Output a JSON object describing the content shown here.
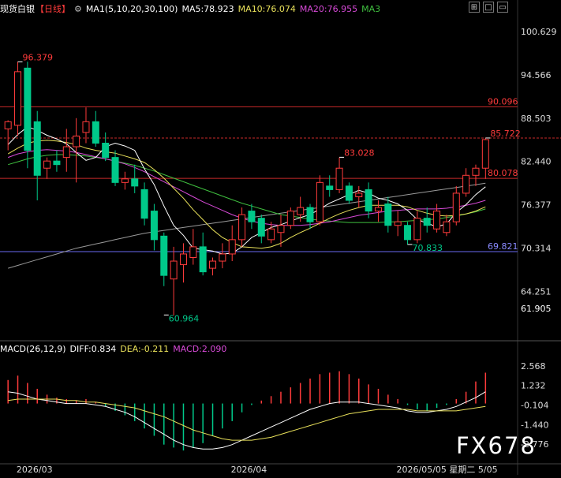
{
  "header": {
    "symbol": "现货白银",
    "period": "【日线】",
    "gear_icon": "gear-icon",
    "ma_label": "MA1(5,10,20,30,100)",
    "ma5": "MA5:78.923",
    "ma10": "MA10:76.074",
    "ma20": "MA20:76.955",
    "ma3": "MA3"
  },
  "window_buttons": [
    "grid-icon",
    "maximize-icon",
    "restore-icon"
  ],
  "macd_header": {
    "label": "MACD(26,12,9)",
    "diff": "DIFF:0.834",
    "dea": "DEA:-0.211",
    "macd": "MACD:2.090"
  },
  "watermark": "FX678",
  "colors": {
    "up": "#ff3b3b",
    "down": "#00c98a",
    "ma5": "#ffffff",
    "ma10": "#e8e05a",
    "ma20": "#d84ad8",
    "ma30": "#3fbf3f",
    "ma100": "#9a9a9a",
    "hline_red": "#c92a2a",
    "hline_blue": "#6a6af0"
  },
  "chart_data": [
    {
      "type": "candlestick",
      "title": "现货白银【日线】",
      "ylim": [
        57.8,
        102.6
      ],
      "yticks": [
        "100.629",
        "94.566",
        "88.503",
        "82.440",
        "76.377",
        "70.314",
        "64.251"
      ],
      "ytick_values": [
        100.629,
        94.566,
        88.503,
        82.44,
        76.377,
        70.314,
        64.251
      ],
      "current_price_label": "61.905",
      "current_price_value": 61.905,
      "xlabels": [
        "2026/03",
        "2026/04",
        "2026/05/05 星期二 5/05"
      ],
      "xlabel_index": [
        2,
        24,
        41
      ],
      "annotations": [
        {
          "text": "96.379",
          "value": 96.379,
          "index": 1,
          "color": "#ff3b3b"
        },
        {
          "text": "83.028",
          "value": 83.028,
          "index": 34,
          "color": "#ff3b3b"
        },
        {
          "text": "60.964",
          "value": 60.964,
          "index": 16,
          "color": "#00c98a"
        },
        {
          "text": "70.833",
          "value": 70.833,
          "index": 41,
          "color": "#00c98a"
        },
        {
          "text": "85.722",
          "value": 85.722,
          "index": 49,
          "color": "#ff3b3b"
        }
      ],
      "hlines": [
        {
          "value": 90.096,
          "label": "90.096",
          "color": "#c92a2a"
        },
        {
          "value": 80.078,
          "label": "80.078",
          "color": "#c92a2a"
        },
        {
          "value": 69.821,
          "label": "69.821",
          "color": "#6a6af0"
        },
        {
          "value": 85.722,
          "label": "",
          "color": "#c92a2a",
          "dashed": true
        }
      ],
      "candles": [
        {
          "o": 87.0,
          "h": 88.2,
          "l": 84.0,
          "c": 88.0
        },
        {
          "o": 87.5,
          "h": 96.4,
          "l": 86.0,
          "c": 95.0
        },
        {
          "o": 95.5,
          "h": 96.4,
          "l": 81.5,
          "c": 84.0
        },
        {
          "o": 88.0,
          "h": 89.5,
          "l": 77.0,
          "c": 80.5
        },
        {
          "o": 81.5,
          "h": 83.0,
          "l": 80.0,
          "c": 82.5
        },
        {
          "o": 82.5,
          "h": 84.0,
          "l": 81.0,
          "c": 82.0
        },
        {
          "o": 83.0,
          "h": 87.0,
          "l": 81.0,
          "c": 84.5
        },
        {
          "o": 84.5,
          "h": 88.5,
          "l": 79.5,
          "c": 86.0
        },
        {
          "o": 86.5,
          "h": 90.0,
          "l": 85.0,
          "c": 88.0
        },
        {
          "o": 88.0,
          "h": 89.5,
          "l": 84.5,
          "c": 85.0
        },
        {
          "o": 85.0,
          "h": 86.5,
          "l": 82.5,
          "c": 83.0
        },
        {
          "o": 83.0,
          "h": 84.0,
          "l": 79.0,
          "c": 79.5
        },
        {
          "o": 79.5,
          "h": 81.0,
          "l": 78.5,
          "c": 80.0
        },
        {
          "o": 80.0,
          "h": 82.0,
          "l": 78.0,
          "c": 79.0
        },
        {
          "o": 78.5,
          "h": 79.5,
          "l": 73.5,
          "c": 74.5
        },
        {
          "o": 75.5,
          "h": 76.5,
          "l": 70.0,
          "c": 71.5
        },
        {
          "o": 72.0,
          "h": 72.5,
          "l": 65.0,
          "c": 66.5
        },
        {
          "o": 66.0,
          "h": 70.5,
          "l": 60.9,
          "c": 68.5
        },
        {
          "o": 68.0,
          "h": 71.0,
          "l": 65.5,
          "c": 69.5
        },
        {
          "o": 69.0,
          "h": 73.0,
          "l": 68.0,
          "c": 70.5
        },
        {
          "o": 70.5,
          "h": 72.5,
          "l": 66.5,
          "c": 67.0
        },
        {
          "o": 67.5,
          "h": 69.0,
          "l": 66.5,
          "c": 68.5
        },
        {
          "o": 68.5,
          "h": 71.0,
          "l": 67.5,
          "c": 69.5
        },
        {
          "o": 69.5,
          "h": 73.5,
          "l": 68.5,
          "c": 71.5
        },
        {
          "o": 71.5,
          "h": 76.0,
          "l": 70.5,
          "c": 75.0
        },
        {
          "o": 75.5,
          "h": 76.5,
          "l": 73.0,
          "c": 74.0
        },
        {
          "o": 74.5,
          "h": 75.0,
          "l": 71.0,
          "c": 72.0
        },
        {
          "o": 71.5,
          "h": 74.0,
          "l": 71.0,
          "c": 73.0
        },
        {
          "o": 72.5,
          "h": 75.0,
          "l": 70.5,
          "c": 73.5
        },
        {
          "o": 73.5,
          "h": 76.0,
          "l": 73.0,
          "c": 75.5
        },
        {
          "o": 75.0,
          "h": 77.5,
          "l": 74.0,
          "c": 76.0
        },
        {
          "o": 76.0,
          "h": 76.5,
          "l": 73.0,
          "c": 74.0
        },
        {
          "o": 74.0,
          "h": 80.5,
          "l": 73.5,
          "c": 79.5
        },
        {
          "o": 79.0,
          "h": 80.5,
          "l": 77.5,
          "c": 78.5
        },
        {
          "o": 78.5,
          "h": 83.0,
          "l": 78.0,
          "c": 81.5
        },
        {
          "o": 79.0,
          "h": 79.5,
          "l": 76.5,
          "c": 77.0
        },
        {
          "o": 77.5,
          "h": 79.0,
          "l": 76.0,
          "c": 78.0
        },
        {
          "o": 78.5,
          "h": 79.5,
          "l": 74.5,
          "c": 75.5
        },
        {
          "o": 75.5,
          "h": 77.0,
          "l": 74.0,
          "c": 76.0
        },
        {
          "o": 76.5,
          "h": 77.5,
          "l": 72.5,
          "c": 73.5
        },
        {
          "o": 73.5,
          "h": 75.5,
          "l": 72.0,
          "c": 74.0
        },
        {
          "o": 73.5,
          "h": 74.0,
          "l": 70.8,
          "c": 71.5
        },
        {
          "o": 71.5,
          "h": 75.5,
          "l": 71.0,
          "c": 74.5
        },
        {
          "o": 74.5,
          "h": 76.0,
          "l": 72.5,
          "c": 73.5
        },
        {
          "o": 73.0,
          "h": 76.5,
          "l": 72.5,
          "c": 75.5
        },
        {
          "o": 72.5,
          "h": 75.0,
          "l": 72.0,
          "c": 74.0
        },
        {
          "o": 74.0,
          "h": 79.0,
          "l": 73.5,
          "c": 78.0
        },
        {
          "o": 78.0,
          "h": 81.5,
          "l": 77.5,
          "c": 80.5
        },
        {
          "o": 80.5,
          "h": 82.0,
          "l": 79.0,
          "c": 81.5
        },
        {
          "o": 81.5,
          "h": 85.7,
          "l": 80.0,
          "c": 85.5
        }
      ],
      "ma5": [
        84.8,
        86.2,
        87.3,
        86.8,
        86.1,
        85.6,
        84.9,
        83.7,
        82.6,
        83.0,
        84.5,
        85.0,
        84.6,
        84.0,
        81.4,
        79.2,
        76.2,
        73.5,
        72.1,
        70.3,
        70.1,
        69.9,
        69.5,
        69.6,
        70.5,
        71.8,
        72.5,
        73.2,
        73.6,
        74.1,
        74.6,
        75.0,
        75.8,
        76.6,
        77.2,
        77.8,
        78.4,
        78.0,
        77.3,
        77.0,
        76.5,
        75.6,
        74.3,
        73.8,
        73.3,
        73.7,
        75.3,
        76.4,
        77.8,
        78.9
      ],
      "ma10": [
        83.5,
        84.3,
        85.0,
        85.3,
        85.4,
        85.3,
        85.1,
        84.8,
        84.3,
        84.0,
        83.8,
        83.6,
        83.2,
        82.8,
        82.3,
        81.3,
        80.1,
        78.7,
        77.3,
        75.7,
        74.3,
        72.9,
        71.8,
        71.1,
        70.5,
        70.4,
        70.3,
        70.5,
        71.0,
        71.8,
        72.5,
        73.1,
        73.8,
        74.5,
        75.1,
        75.6,
        76.0,
        76.3,
        76.3,
        76.3,
        76.3,
        76.1,
        75.6,
        75.2,
        74.9,
        74.8,
        74.9,
        75.1,
        75.5,
        76.1
      ],
      "ma20": [
        83.0,
        83.5,
        83.8,
        84.0,
        84.1,
        84.0,
        83.9,
        83.7,
        83.4,
        83.1,
        82.8,
        82.5,
        82.1,
        81.6,
        81.0,
        80.3,
        79.6,
        78.9,
        78.2,
        77.5,
        76.8,
        76.2,
        75.6,
        75.0,
        74.5,
        74.1,
        73.8,
        73.6,
        73.5,
        73.5,
        73.5,
        73.6,
        73.8,
        74.0,
        74.3,
        74.6,
        74.9,
        75.1,
        75.3,
        75.5,
        75.6,
        75.7,
        75.8,
        75.8,
        75.8,
        75.9,
        76.1,
        76.3,
        76.6,
        77.0
      ],
      "ma30": [
        82.0,
        82.4,
        82.8,
        83.1,
        83.3,
        83.4,
        83.4,
        83.3,
        83.2,
        83.0,
        82.8,
        82.5,
        82.2,
        81.9,
        81.5,
        81.1,
        80.6,
        80.1,
        79.6,
        79.1,
        78.6,
        78.1,
        77.6,
        77.1,
        76.6,
        76.2,
        75.8,
        75.4,
        75.0,
        74.8,
        74.6,
        74.4,
        74.2,
        74.1,
        74.0,
        73.9,
        73.9,
        73.9,
        73.9,
        74.0,
        74.0,
        74.1,
        74.2,
        74.3,
        74.4,
        74.6,
        74.8,
        75.1,
        75.4,
        75.8
      ],
      "ma100": [
        67.5,
        67.9,
        68.3,
        68.7,
        69.1,
        69.5,
        69.9,
        70.3,
        70.6,
        70.9,
        71.2,
        71.5,
        71.8,
        72.1,
        72.4,
        72.6,
        72.8,
        73.0,
        73.2,
        73.4,
        73.6,
        73.8,
        74.0,
        74.2,
        74.4,
        74.6,
        74.8,
        75.0,
        75.2,
        75.4,
        75.6,
        75.8,
        76.0,
        76.2,
        76.4,
        76.6,
        76.8,
        77.0,
        77.2,
        77.4,
        77.6,
        77.8,
        78.0,
        78.2,
        78.4,
        78.6,
        78.8,
        79.0,
        79.2,
        79.4
      ]
    },
    {
      "type": "macd",
      "title": "MACD(26,12,9)",
      "ylim": [
        -4.0,
        3.2
      ],
      "yticks": [
        "2.568",
        "1.232",
        "-0.104",
        "-1.440",
        "-2.776"
      ],
      "ytick_values": [
        2.568,
        1.232,
        -0.104,
        -1.44,
        -2.776
      ],
      "histogram": [
        1.6,
        1.9,
        1.4,
        1.0,
        0.6,
        0.4,
        0.3,
        0.2,
        0.3,
        0.1,
        -0.2,
        -0.5,
        -0.8,
        -1.2,
        -1.7,
        -2.2,
        -2.8,
        -3.0,
        -3.2,
        -3.0,
        -2.7,
        -2.2,
        -1.7,
        -1.2,
        -0.6,
        -0.1,
        0.2,
        0.5,
        0.8,
        1.1,
        1.4,
        1.7,
        2.0,
        2.1,
        2.2,
        2.0,
        1.7,
        1.3,
        1.0,
        0.6,
        0.3,
        -0.1,
        -0.4,
        -0.5,
        -0.3,
        -0.1,
        0.3,
        0.8,
        1.5,
        2.1
      ],
      "diff": [
        0.8,
        0.7,
        0.5,
        0.3,
        0.2,
        0.1,
        0.0,
        0.0,
        0.0,
        -0.1,
        -0.2,
        -0.4,
        -0.6,
        -0.9,
        -1.3,
        -1.7,
        -2.1,
        -2.5,
        -2.8,
        -3.0,
        -3.1,
        -3.1,
        -3.0,
        -2.8,
        -2.5,
        -2.2,
        -1.9,
        -1.6,
        -1.3,
        -1.0,
        -0.7,
        -0.4,
        -0.2,
        0.0,
        0.1,
        0.1,
        0.1,
        0.0,
        -0.1,
        -0.2,
        -0.3,
        -0.5,
        -0.6,
        -0.6,
        -0.5,
        -0.4,
        -0.2,
        0.1,
        0.4,
        0.8
      ],
      "dea": [
        0.2,
        0.3,
        0.3,
        0.3,
        0.3,
        0.3,
        0.2,
        0.2,
        0.1,
        0.1,
        0.0,
        -0.1,
        -0.2,
        -0.3,
        -0.5,
        -0.7,
        -0.9,
        -1.2,
        -1.5,
        -1.8,
        -2.0,
        -2.2,
        -2.4,
        -2.5,
        -2.5,
        -2.5,
        -2.4,
        -2.3,
        -2.1,
        -1.9,
        -1.7,
        -1.5,
        -1.3,
        -1.1,
        -0.9,
        -0.7,
        -0.6,
        -0.5,
        -0.4,
        -0.4,
        -0.4,
        -0.4,
        -0.5,
        -0.5,
        -0.5,
        -0.5,
        -0.5,
        -0.4,
        -0.3,
        -0.2
      ]
    }
  ]
}
